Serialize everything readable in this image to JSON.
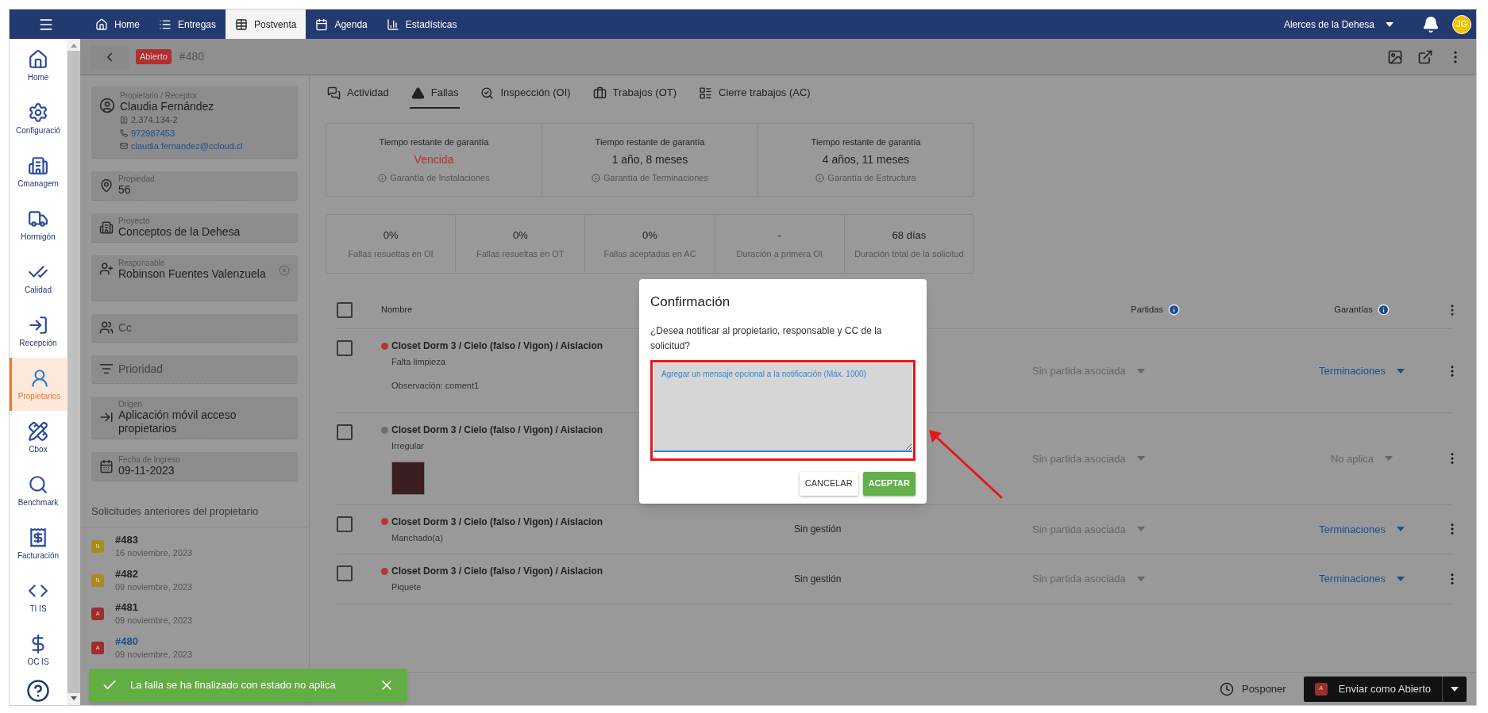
{
  "topbar": {
    "tabs": [
      {
        "label": "Home",
        "selected": false
      },
      {
        "label": "Entregas",
        "selected": false
      },
      {
        "label": "Postventa",
        "selected": true
      },
      {
        "label": "Agenda",
        "selected": false
      },
      {
        "label": "Estadísticas",
        "selected": false
      }
    ],
    "project": "Alerces de la Dehesa",
    "avatar": "JG"
  },
  "sidebar": {
    "items": [
      {
        "label": "Home",
        "selected": false
      },
      {
        "label": "Configuració",
        "selected": false
      },
      {
        "label": "Cmanagem",
        "selected": false
      },
      {
        "label": "Hormigón",
        "selected": false
      },
      {
        "label": "Calidad",
        "selected": false
      },
      {
        "label": "Recepción",
        "selected": false
      },
      {
        "label": "Propietarios",
        "selected": true
      },
      {
        "label": "Cbox",
        "selected": false
      },
      {
        "label": "Benchmark",
        "selected": false
      },
      {
        "label": "Facturación",
        "selected": false
      },
      {
        "label": "TI IS",
        "selected": false
      },
      {
        "label": "OC IS",
        "selected": false
      }
    ]
  },
  "header": {
    "status": "Abierto",
    "number": "#480"
  },
  "info": {
    "fields": [
      {
        "kind": "owner",
        "label": "Propietario / Receptor",
        "value": "Claudia Fernández",
        "rut": "2.374.134-2",
        "phone": "972987453",
        "email": "claudia.fernandez@ccloud.cl"
      },
      {
        "kind": "property",
        "label": "Propiedad",
        "value": "56"
      },
      {
        "kind": "project",
        "label": "Proyecto",
        "value": "Conceptos de la Dehesa"
      },
      {
        "kind": "responsible",
        "label": "Responsable",
        "value": "Robinson Fuentes Valenzuela"
      },
      {
        "kind": "cc",
        "placeholder": "Cc"
      },
      {
        "kind": "priority",
        "placeholder": "Prioridad"
      },
      {
        "kind": "origin",
        "label": "Origen",
        "value": "Aplicación móvil acceso propietarios"
      },
      {
        "kind": "date",
        "label": "Fecha de Ingreso",
        "value": "09-11-2023"
      }
    ],
    "previous_title": "Solicitudes anteriores del propietario",
    "previous": [
      {
        "badge": "N",
        "color": "#a88a1f",
        "number": "#483",
        "date": "16 noviembre, 2023",
        "selected": false
      },
      {
        "badge": "N",
        "color": "#a88a1f",
        "number": "#482",
        "date": "09 noviembre, 2023",
        "selected": false
      },
      {
        "badge": "A",
        "color": "#9c2e2e",
        "number": "#481",
        "date": "09 noviembre, 2023",
        "selected": false
      },
      {
        "badge": "A",
        "color": "#9c2e2e",
        "number": "#480",
        "date": "09 noviembre, 2023",
        "selected": true
      }
    ]
  },
  "tabs": [
    {
      "label": "Actividad",
      "selected": false
    },
    {
      "label": "Fallas",
      "selected": true
    },
    {
      "label": "Inspección (OI)",
      "selected": false
    },
    {
      "label": "Trabajos (OT)",
      "selected": false
    },
    {
      "label": "Cierre trabajos (AC)",
      "selected": false
    }
  ],
  "warranties": [
    {
      "title": "Tiempo restante de garantía",
      "value": "Vencida",
      "expired": true,
      "note": "Garantía de Instalaciones"
    },
    {
      "title": "Tiempo restante de garantía",
      "value": "1 año, 8 meses",
      "expired": false,
      "note": "Garantía de Terminaciones"
    },
    {
      "title": "Tiempo restante de garantía",
      "value": "4 años, 11 meses",
      "expired": false,
      "note": "Garantía de Estructura"
    }
  ],
  "metrics": [
    {
      "value": "0%",
      "label": "Fallas resueltas en OI"
    },
    {
      "value": "0%",
      "label": "Fallas resueltas en OT"
    },
    {
      "value": "0%",
      "label": "Fallas aceptadas en AC"
    },
    {
      "value": "-",
      "label": "Duración a primera OI"
    },
    {
      "value": "68 días",
      "label": "Duración total de la solicitud"
    }
  ],
  "table": {
    "columns": [
      "Nombre",
      "Partidas",
      "Garantías"
    ],
    "all_checked": false,
    "rows": [
      {
        "checked": false,
        "color": "#b03a30",
        "path": "Closet Dorm 3 / Cielo (falso / Vigon) / Aislacion",
        "problem": "Falta limpieza",
        "observation": "Observación: coment1",
        "partida": "Sin partida asociada",
        "garantia": "Terminaciones",
        "applicable": true
      },
      {
        "checked": false,
        "color": "#6e6e6e",
        "path": "Closet Dorm 3 / Cielo (falso / Vigon) / Aislacion",
        "problem": "Irregular",
        "photo": true,
        "partida": "Sin partida asociada",
        "garantia": "No aplica",
        "applicable": false
      },
      {
        "checked": false,
        "color": "#b03a30",
        "path": "Closet Dorm 3 / Cielo (falso / Vigon) / Aislacion",
        "problem": "Manchado(a)",
        "status": "Sin gestión",
        "partida": "Sin partida asociada",
        "garantia": "Terminaciones",
        "applicable": true
      },
      {
        "checked": false,
        "color": "#b03a30",
        "path": "Closet Dorm 3 / Cielo (falso / Vigon) / Aislacion",
        "problem": "Piquete",
        "status": "Sin gestión",
        "partida": "Sin partida asociada",
        "garantia": "Terminaciones",
        "applicable": true
      }
    ]
  },
  "dialog": {
    "title": "Confirmación",
    "message": "¿Desea notificar al propietario, responsable y CC de la solicitud?",
    "placeholder": "Agregar un mensaje opcional a la notificación (Máx. 1000)",
    "cancel": "CANCELAR",
    "accept": "ACEPTAR"
  },
  "toast": {
    "message": "La falla se ha finalizado con estado no aplica"
  },
  "footer": {
    "postpone": "Posponer",
    "send": "Enviar como Abierto",
    "send_badge": "A"
  }
}
